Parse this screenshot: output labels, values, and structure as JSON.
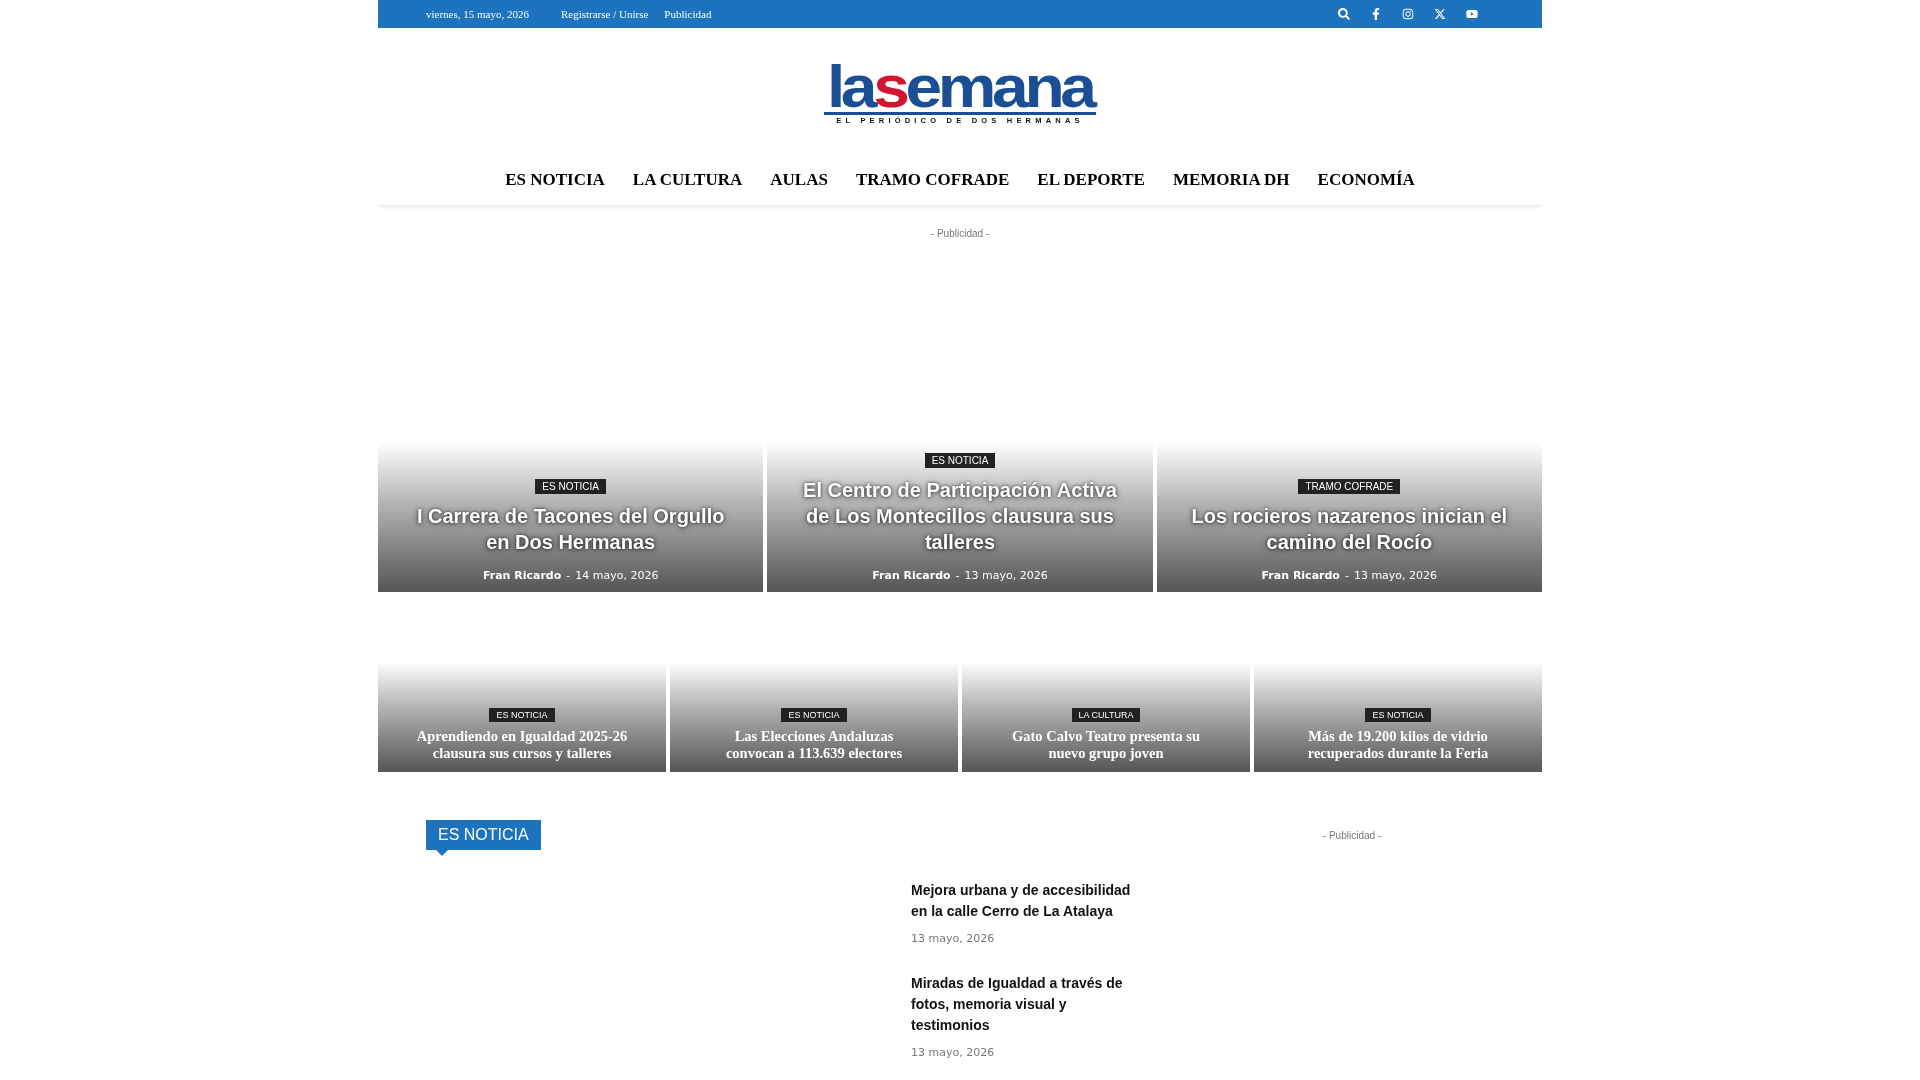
{
  "top_bar": {
    "date": "viernes, 15 mayo, 2026",
    "links": [
      "Registrarse / Unirse",
      "Publicidad"
    ]
  },
  "logo": {
    "parts": [
      {
        "text": "la",
        "color": "#1b4f93"
      },
      {
        "text": "s",
        "color": "#d4152f"
      },
      {
        "text": "emana",
        "color": "#1b4f93"
      }
    ],
    "tagline": "EL PERIÓDICO DE DOS HERMANAS"
  },
  "nav": [
    "ES NOTICIA",
    "LA CULTURA",
    "AULAS",
    "TRAMO COFRADE",
    "EL DEPORTE",
    "MEMORIA DH",
    "ECONOMÍA"
  ],
  "ad_label": "- Publicidad -",
  "featured": [
    {
      "category": "ES NOTICIA",
      "title": "I Carrera de Tacones del Orgullo en Dos Hermanas",
      "author": "Fran Ricardo",
      "separator": "-",
      "date": "14 mayo, 2026"
    },
    {
      "category": "ES NOTICIA",
      "title": "El Centro de Participación Activa de Los Montecillos clausura sus talleres",
      "author": "Fran Ricardo",
      "separator": "-",
      "date": "13 mayo, 2026"
    },
    {
      "category": "TRAMO COFRADE",
      "title": "Los rocieros nazarenos inician el camino del Rocío",
      "author": "Fran Ricardo",
      "separator": "-",
      "date": "13 mayo, 2026"
    }
  ],
  "secondary": [
    {
      "category": "ES NOTICIA",
      "title": "Aprendiendo en Igualdad 2025-26 clausura sus cursos y talleres"
    },
    {
      "category": "ES NOTICIA",
      "title": "Las Elecciones Andaluzas convocan a 113.639 electores"
    },
    {
      "category": "LA CULTURA",
      "title": "Gato Calvo Teatro presenta su nuevo grupo joven"
    },
    {
      "category": "ES NOTICIA",
      "title": "Más de 19.200 kilos de vidrio recuperados durante la Feria"
    }
  ],
  "section": {
    "title": "ES NOTICIA",
    "articles": [
      {
        "title": "Mejora urbana y de accesibilidad en la calle Cerro de La Atalaya",
        "date": "13 mayo, 2026"
      },
      {
        "title": "Miradas de Igualdad a través de fotos, memoria visual y testimonios",
        "date": "13 mayo, 2026"
      }
    ]
  },
  "sidebar_ad_label": "- Publicidad -"
}
